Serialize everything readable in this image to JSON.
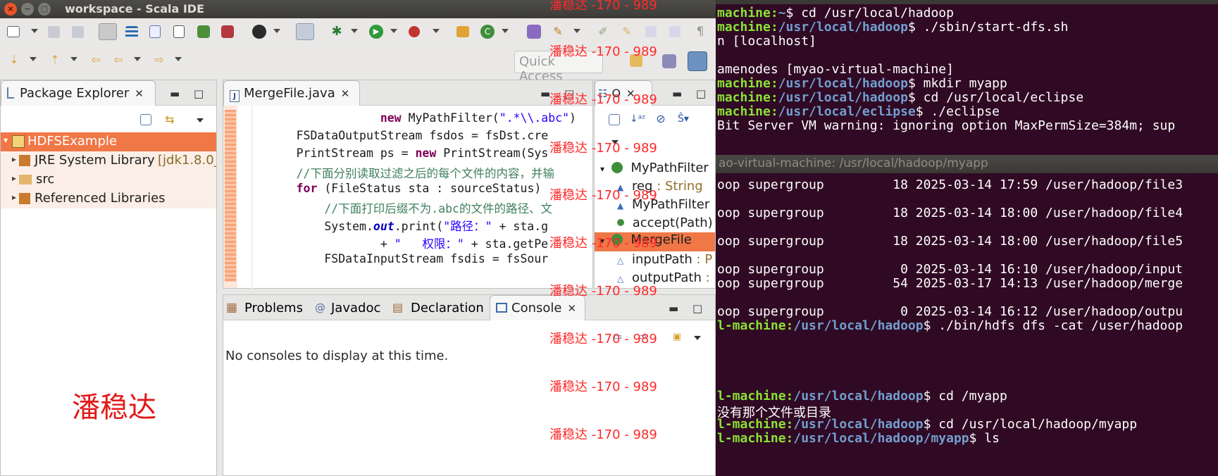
{
  "window": {
    "title": "workspace - Scala IDE",
    "close_glyph": "×",
    "min_glyph": "−",
    "max_glyph": "□"
  },
  "quick_access": {
    "placeholder": "Quick Access"
  },
  "package_explorer": {
    "tab_label": "Package Explorer",
    "tree": [
      {
        "label": "HDFSExample",
        "selected": true
      },
      {
        "label": "JRE System Library",
        "suffix": "[jdk1.8.0_"
      },
      {
        "label": "src"
      },
      {
        "label": "Referenced Libraries"
      }
    ]
  },
  "editor": {
    "tab_label": "MergeFile.java",
    "lines": [
      {
        "indent": "                  ",
        "parts": [
          {
            "t": "new ",
            "c": "kw"
          },
          {
            "t": "MyPathFilter(",
            "c": ""
          },
          {
            "t": "\".*\\\\.abc\"",
            "c": "str"
          },
          {
            "t": ")",
            "c": ""
          }
        ]
      },
      {
        "indent": "      ",
        "parts": [
          {
            "t": "FSDataOutputStream fsdos = fsDst.cre",
            "c": ""
          }
        ]
      },
      {
        "indent": "      ",
        "parts": [
          {
            "t": "PrintStream ps = ",
            "c": ""
          },
          {
            "t": "new ",
            "c": "kw"
          },
          {
            "t": "PrintStream(Sys",
            "c": ""
          }
        ]
      },
      {
        "indent": "      ",
        "parts": [
          {
            "t": "//下面分别读取过滤之后的每个文件的内容，并输",
            "c": "cm"
          }
        ]
      },
      {
        "indent": "      ",
        "parts": [
          {
            "t": "for ",
            "c": "kw"
          },
          {
            "t": "(FileStatus sta : sourceStatus)",
            "c": ""
          }
        ]
      },
      {
        "indent": "          ",
        "parts": [
          {
            "t": "//下面打印后缀不为.abc的文件的路径、文",
            "c": "cm"
          }
        ]
      },
      {
        "indent": "          ",
        "parts": [
          {
            "t": "System.",
            "c": ""
          },
          {
            "t": "out",
            "c": "sfld"
          },
          {
            "t": ".print(",
            "c": ""
          },
          {
            "t": "\"路径：\"",
            "c": "str"
          },
          {
            "t": " + sta.g",
            "c": ""
          }
        ]
      },
      {
        "indent": "                  ",
        "parts": [
          {
            "t": "+ ",
            "c": ""
          },
          {
            "t": "\"   权限：\"",
            "c": "str"
          },
          {
            "t": " + sta.getPe",
            "c": ""
          }
        ]
      },
      {
        "indent": "          ",
        "parts": [
          {
            "t": "FSDataInputStream fsdis = fsSour",
            "c": ""
          }
        ]
      }
    ]
  },
  "outline": {
    "items": [
      {
        "label": "MyPathFilter",
        "type": ""
      },
      {
        "label": "reg",
        "type": " : String"
      },
      {
        "label": "MyPathFilter",
        "type": ""
      },
      {
        "label": "accept(Path)",
        "type": ""
      },
      {
        "label": "MergeFile",
        "type": ""
      },
      {
        "label": "inputPath",
        "type": " : P"
      },
      {
        "label": "outputPath",
        "type": " :"
      }
    ]
  },
  "bottom_tabs": {
    "problems": "Problems",
    "javadoc": "Javadoc",
    "declaration": "Declaration",
    "console": "Console",
    "console_message": "No consoles to display at this time."
  },
  "terminal_top": [
    {
      "user": "machine:",
      "path": "~",
      "cmd": "$ cd /usr/local/hadoop"
    },
    {
      "user": "machine:",
      "path": "/usr/local/hadoop",
      "cmd": "$ ./sbin/start-dfs.sh"
    },
    {
      "text": "n [localhost]"
    },
    {
      "text": ""
    },
    {
      "text": "amenodes [myao-virtual-machine]"
    },
    {
      "user": "machine:",
      "path": "/usr/local/hadoop",
      "cmd": "$ mkdir myapp"
    },
    {
      "user": "machine:",
      "path": "/usr/local/hadoop",
      "cmd": "$ cd /usr/local/eclipse"
    },
    {
      "user": "machine:",
      "path": "/usr/local/eclipse",
      "cmd": "$ ./eclipse"
    },
    {
      "text": "Bit Server VM warning: ignoring option MaxPermSize=384m; sup"
    }
  ],
  "terminal_bottom_title": "ao-virtual-machine: /usr/local/hadoop/myapp",
  "terminal_bottom": [
    {
      "text": "oop supergroup         18 2025-03-14 17:59 /user/hadoop/file3"
    },
    {
      "text": ""
    },
    {
      "text": "oop supergroup         18 2025-03-14 18:00 /user/hadoop/file4"
    },
    {
      "text": ""
    },
    {
      "text": "oop supergroup         18 2025-03-14 18:00 /user/hadoop/file5"
    },
    {
      "text": ""
    },
    {
      "text": "oop supergroup          0 2025-03-14 16:10 /user/hadoop/input"
    },
    {
      "text": "oop supergroup         54 2025-03-17 14:13 /user/hadoop/merge"
    },
    {
      "text": ""
    },
    {
      "text": "oop supergroup          0 2025-03-14 16:12 /user/hadoop/outpu"
    },
    {
      "user": "l-machine:",
      "path": "/usr/local/hadoop",
      "cmd": "$ ./bin/hdfs dfs -cat /user/hadoop"
    },
    {
      "text": ""
    },
    {
      "text": ""
    },
    {
      "text": ""
    },
    {
      "text": ""
    },
    {
      "user": "l-machine:",
      "path": "/usr/local/hadoop",
      "cmd": "$ cd /myapp"
    },
    {
      "text": "没有那个文件或目录"
    },
    {
      "user": "l-machine:",
      "path": "/usr/local/hadoop",
      "cmd": "$ cd /usr/local/hadoop/myapp"
    },
    {
      "user": "l-machine:",
      "path": "/usr/local/hadoop/myapp",
      "cmd": "$ ls"
    }
  ],
  "watermark": {
    "small": "潘稳达 -170 - 989",
    "big": "潘稳达"
  },
  "colors": {
    "selection": "#f07746",
    "terminal_bg": "#300a24",
    "prompt_user": "#8ae234",
    "prompt_path": "#729fcf",
    "watermark": "#ff2a2a"
  }
}
